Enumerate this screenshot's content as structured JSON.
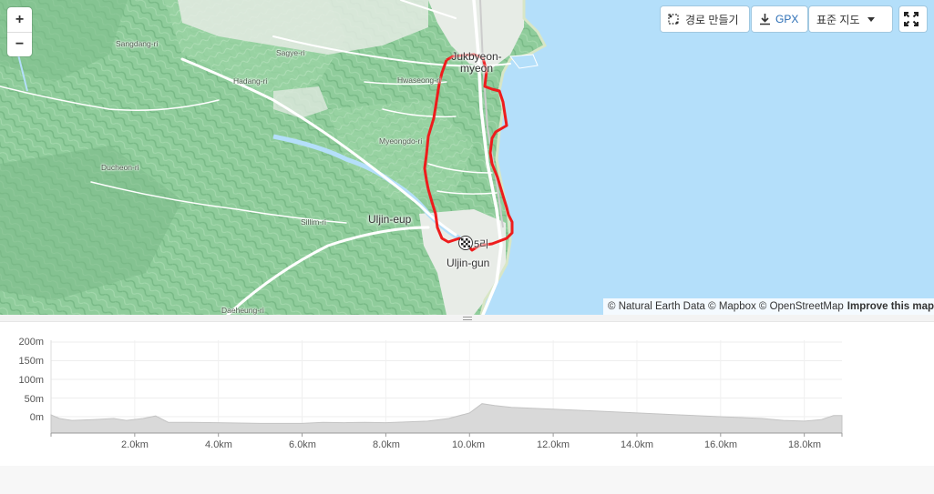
{
  "map": {
    "places": [
      {
        "id": "sangdang",
        "name": "Sangdang-ri"
      },
      {
        "id": "sagye",
        "name": "Sagye-ri"
      },
      {
        "id": "hadang",
        "name": "Hadang-ri"
      },
      {
        "id": "hwaseong",
        "name": "Hwaseong-ri"
      },
      {
        "id": "myeongdo",
        "name": "Myeongdo-ri"
      },
      {
        "id": "ducheon",
        "name": "Ducheon-ri"
      },
      {
        "id": "sillim",
        "name": "Sillim-ri"
      },
      {
        "id": "daeheung",
        "name": "Daeheung-ri"
      }
    ],
    "major_places": {
      "jukbyeon": "Jukbyeon-\nmyeon",
      "uljin_eup": "Uljin-eup",
      "uljin_gun": "Uljin-gun",
      "finish_label": "5리"
    },
    "zoom_in": "+",
    "zoom_out": "−",
    "controls": {
      "route_builder": "경로 만들기",
      "gpx": "GPX",
      "map_style": "표준 지도"
    },
    "attribution": {
      "text": "© Natural Earth Data © Mapbox © OpenStreetMap",
      "improve": "Improve this map"
    },
    "colors": {
      "route": "#ee1c1c",
      "water": "#b4dffa",
      "land": "#8fcc9b"
    }
  },
  "elevation": {
    "y_ticks": [
      "200m",
      "150m",
      "100m",
      "50m",
      "0m"
    ],
    "x_ticks": [
      "2.0km",
      "4.0km",
      "6.0km",
      "8.0km",
      "10.0km",
      "12.0km",
      "14.0km",
      "16.0km",
      "18.0km"
    ],
    "chart_data": {
      "type": "area",
      "xlabel": "",
      "ylabel": "",
      "x_unit": "km",
      "y_unit": "m",
      "xlim": [
        0,
        18.9
      ],
      "ylim": [
        0,
        200
      ],
      "x": [
        0,
        0.2,
        0.5,
        1.0,
        1.5,
        1.8,
        2.2,
        2.5,
        2.8,
        3.3,
        4,
        5,
        6,
        6.5,
        7,
        7.5,
        8,
        8.5,
        9,
        9.5,
        10.0,
        10.3,
        10.6,
        11,
        12,
        13,
        14,
        15,
        16,
        17,
        17.5,
        18.0,
        18.4,
        18.7,
        18.9
      ],
      "y": [
        5,
        -5,
        -10,
        -8,
        -5,
        -10,
        -5,
        2,
        -15,
        -15,
        -16,
        -18,
        -18,
        -15,
        -16,
        -15,
        -16,
        -14,
        -12,
        -5,
        10,
        35,
        30,
        25,
        20,
        15,
        10,
        5,
        0,
        -5,
        -10,
        -12,
        -8,
        3,
        3
      ]
    },
    "colors": {
      "fill": "#d9d9d9",
      "stroke": "#c4c4c4"
    }
  }
}
